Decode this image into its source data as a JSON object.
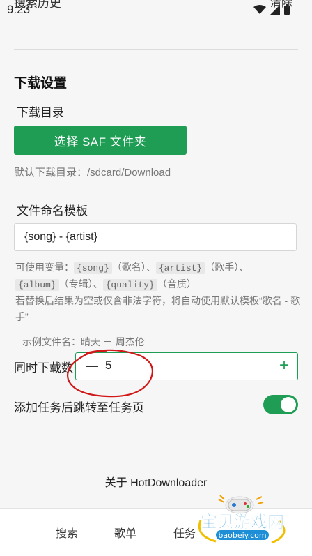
{
  "status_bar": {
    "time": "9:23"
  },
  "history": {
    "title": "搜索历史",
    "clear_label": "清除"
  },
  "download_settings": {
    "section_title": "下载设置",
    "dir_label": "下载目录",
    "saf_button": "选择 SAF 文件夹",
    "default_dir": "默认下载目录：/sdcard/Download",
    "template_label": "文件命名模板",
    "template_value": "{song} - {artist}",
    "hint": {
      "prefix": "可使用变量：",
      "var_song": "{song}",
      "desc_song": "（歌名）、",
      "var_artist": "{artist}",
      "desc_artist": "（歌手）、",
      "var_album": "{album}",
      "desc_album": "（专辑）、",
      "var_quality": "{quality}",
      "desc_quality": "（音质）",
      "fallback": "若替换后结果为空或仅含非法字符，将自动使用默认模板“歌名 - 歌手”"
    },
    "example": "示例文件名：晴天 － 周杰伦",
    "concurrent_label": "同时下载数",
    "concurrent_minus": "—",
    "concurrent_value": "5",
    "concurrent_plus": "+",
    "jump_label": "添加任务后跳转至任务页",
    "jump_enabled": true
  },
  "about": "关于 HotDownloader",
  "nav": [
    "搜索",
    "歌单",
    "任务"
  ],
  "watermark": {
    "brand": "宝贝游戏网",
    "domain": "baobeiy.com"
  },
  "colors": {
    "accent": "#1f9d55",
    "annotation": "#d01818",
    "watermark": "#1e8fd6"
  }
}
